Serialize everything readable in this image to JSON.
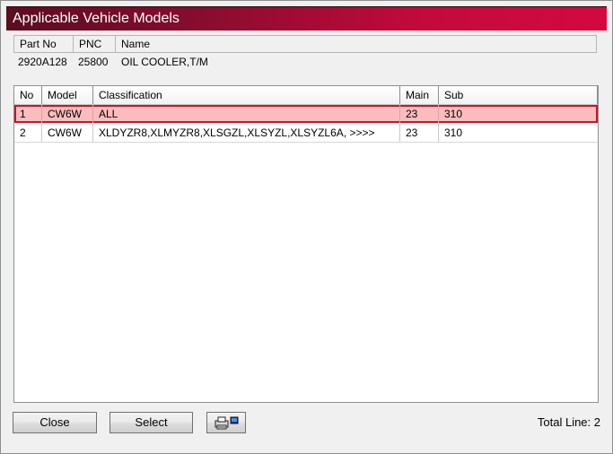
{
  "window": {
    "title": "Applicable Vehicle Models"
  },
  "part_info": {
    "headers": {
      "part_no": "Part No",
      "pnc": "PNC",
      "name": "Name"
    },
    "values": {
      "part_no": "2920A128",
      "pnc": "25800",
      "name": "OIL COOLER,T/M"
    }
  },
  "list": {
    "headers": {
      "no": "No",
      "model": "Model",
      "classification": "Classification",
      "main": "Main",
      "sub": "Sub"
    },
    "rows": [
      {
        "no": "1",
        "model": "CW6W",
        "classification": "ALL",
        "main": "23",
        "sub": "310",
        "selected": true
      },
      {
        "no": "2",
        "model": "CW6W",
        "classification": "XLDYZR8,XLMYZR8,XLSGZL,XLSYZL,XLSYZL6A,  >>>>",
        "main": "23",
        "sub": "310",
        "selected": false
      }
    ]
  },
  "buttons": {
    "close": "Close",
    "select": "Select",
    "print_icon": "printer-icon"
  },
  "footer": {
    "total_line": "Total Line: 2"
  },
  "colors": {
    "title_gradient_start": "#5a0d22",
    "title_gradient_end": "#d3093f",
    "selected_row": "#f9bdbd",
    "selected_border": "#c0182c"
  }
}
